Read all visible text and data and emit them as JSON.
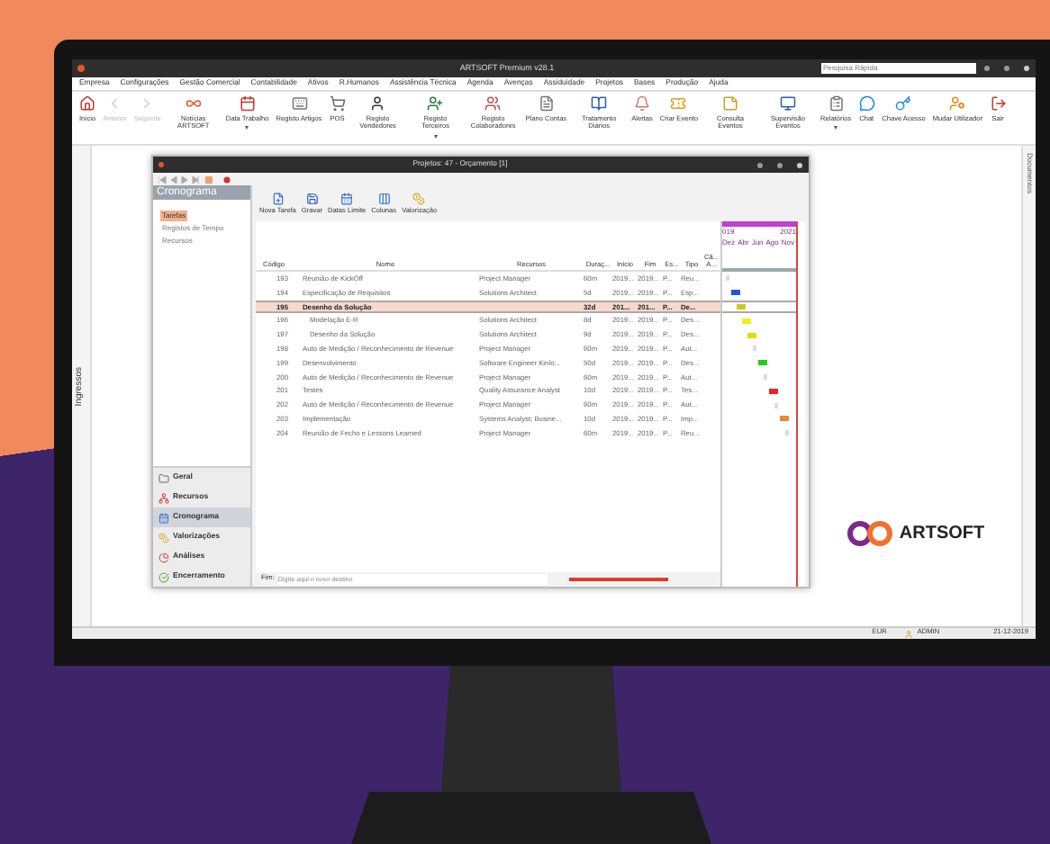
{
  "window": {
    "title": "ARTSOFT Premium v28.1",
    "search": {
      "placeholder": "Pesquisa Rápida"
    }
  },
  "menu": [
    "Empresa",
    "Configurações",
    "Gestão Comercial",
    "Contabilidade",
    "Ativos",
    "R.Humanos",
    "Assistência Técnica",
    "Agenda",
    "Avenças",
    "Assiduidade",
    "Projetos",
    "Bases",
    "Produção",
    "Ajuda"
  ],
  "toolbar": [
    {
      "label": "Início",
      "disabled": false,
      "dropdown": false
    },
    {
      "label": "Anterior",
      "disabled": true,
      "dropdown": false
    },
    {
      "label": "Seguinte",
      "disabled": true,
      "dropdown": false
    },
    {
      "label": "Notícias ARTSOFT",
      "disabled": false,
      "dropdown": false
    },
    {
      "label": "Data Trabalho",
      "disabled": false,
      "dropdown": true
    },
    {
      "label": "Registo Artigos",
      "disabled": false,
      "dropdown": false
    },
    {
      "label": "POS",
      "disabled": false,
      "dropdown": false
    },
    {
      "label": "Registo Vendedores",
      "disabled": false,
      "dropdown": false
    },
    {
      "label": "Registo Terceiros",
      "disabled": false,
      "dropdown": true
    },
    {
      "label": "Registo Colaboradores",
      "disabled": false,
      "dropdown": false
    },
    {
      "label": "Plano Contas",
      "disabled": false,
      "dropdown": false
    },
    {
      "label": "Tratamento Diários",
      "disabled": false,
      "dropdown": false
    },
    {
      "label": "Alertas",
      "disabled": false,
      "dropdown": false
    },
    {
      "label": "Criar Evento",
      "disabled": false,
      "dropdown": false
    },
    {
      "label": "Consulta Eventos",
      "disabled": false,
      "dropdown": false
    },
    {
      "label": "Supervisão Eventos",
      "disabled": false,
      "dropdown": false
    },
    {
      "label": "Relatórios",
      "disabled": false,
      "dropdown": true
    },
    {
      "label": "Chat",
      "disabled": false,
      "dropdown": false
    },
    {
      "label": "Chave Acesso",
      "disabled": false,
      "dropdown": false
    },
    {
      "label": "Mudar Utilizador",
      "disabled": false,
      "dropdown": false
    },
    {
      "label": "Sair",
      "disabled": false,
      "dropdown": false
    }
  ],
  "side_tabs": {
    "left": "Ingressos",
    "right": "Documentos"
  },
  "project_window": {
    "title": "Projetos: 47 - Orçamento [1]",
    "panel_title": "Cronograma",
    "panel_items": [
      {
        "label": "Tarefas",
        "selected": true
      },
      {
        "label": "Registos de Tempo",
        "selected": false
      },
      {
        "label": "Recursos",
        "selected": false
      }
    ],
    "sections": [
      {
        "label": "Geral",
        "selected": false
      },
      {
        "label": "Recursos",
        "selected": false
      },
      {
        "label": "Cronograma",
        "selected": true
      },
      {
        "label": "Valorizações",
        "selected": false
      },
      {
        "label": "Análises",
        "selected": false
      },
      {
        "label": "Encerramento",
        "selected": false
      }
    ],
    "toolbar": [
      "Nova Tarefa",
      "Gravar",
      "Datas Limite",
      "Colunas",
      "Valorização"
    ],
    "table": {
      "columns": [
        "Código",
        "Nome",
        "Recursos",
        "Duraç...",
        "Início",
        "Fim",
        "Es...",
        "Tipo",
        "Cã... A..."
      ],
      "rows": [
        {
          "code": "193",
          "name": "Reunião de KickOff",
          "resources": "Project Manager",
          "duration": "60m",
          "start": "2019...",
          "end": "2019...",
          "state": "P...",
          "type": "Reu...",
          "selected": false,
          "color": "#d8d8f0"
        },
        {
          "code": "194",
          "name": "Especificação de Requisitos",
          "resources": "Solutions Architect",
          "duration": "5d",
          "start": "2019...",
          "end": "2019...",
          "state": "P...",
          "type": "Esp...",
          "selected": false,
          "color": "#2255dd"
        },
        {
          "code": "195",
          "name": "Desenho da Solução",
          "resources": "",
          "duration": "32d",
          "start": "201...",
          "end": "201...",
          "state": "P...",
          "type": "De...",
          "selected": true,
          "color": "#cccc22",
          "children": [
            {
              "code": "196",
              "name": "Modelação E-R",
              "resources": "Solutions Architect",
              "duration": "8d",
              "start": "2019...",
              "end": "2019...",
              "state": "P...",
              "type": "Des...",
              "selected": false,
              "color": "#eeee22"
            },
            {
              "code": "197",
              "name": "Desenho da Solução",
              "resources": "Solutions Architect",
              "duration": "9d",
              "start": "2019...",
              "end": "2019...",
              "state": "P...",
              "type": "Des...",
              "selected": false,
              "color": "#dddd11"
            }
          ]
        },
        {
          "code": "198",
          "name": "Auto de Medição / Reconhecimento de Revenue",
          "resources": "Project Manager",
          "duration": "60m",
          "start": "2019...",
          "end": "2019...",
          "state": "P...",
          "type": "Aut...",
          "selected": false,
          "color": "#d8d8f0"
        },
        {
          "code": "199",
          "name": "Desenvolvimento",
          "resources": "Software Engineer Kinlo...",
          "duration": "50d",
          "start": "2019...",
          "end": "2019...",
          "state": "P...",
          "type": "Des...",
          "selected": false,
          "color": "#22cc22"
        },
        {
          "code": "200",
          "name": "Auto de Medição / Reconhecimento de Revenue",
          "resources": "Project Manager",
          "duration": "60m",
          "start": "2019...",
          "end": "2019...",
          "state": "P...",
          "type": "Aut...",
          "selected": false,
          "color": "#d8d8f0"
        },
        {
          "code": "201",
          "name": "Testes",
          "resources": "Quality Assurance Analyst",
          "duration": "10d",
          "start": "2019...",
          "end": "2019...",
          "state": "P...",
          "type": "Tes...",
          "selected": false,
          "color": "#ee2222"
        },
        {
          "code": "202",
          "name": "Auto de Medição / Reconhecimento de Revenue",
          "resources": "Project Manager",
          "duration": "60m",
          "start": "2019...",
          "end": "2019...",
          "state": "P...",
          "type": "Aut...",
          "selected": false,
          "color": "#d8d8f0"
        },
        {
          "code": "203",
          "name": "Implementação",
          "resources": "Systems Analyst; Busine...",
          "duration": "10d",
          "start": "2019...",
          "end": "2019...",
          "state": "P...",
          "type": "Imp...",
          "selected": false,
          "color": "#e8883a"
        },
        {
          "code": "204",
          "name": "Reunião de Fecho e Lessons Learned",
          "resources": "Project Manager",
          "duration": "60m",
          "start": "2019...",
          "end": "2019...",
          "state": "P...",
          "type": "Reu...",
          "selected": false,
          "color": "#d8d8f0"
        }
      ]
    },
    "gantt": {
      "years": [
        "019",
        "2021"
      ],
      "months": [
        "Dez",
        "Abr",
        "Jun",
        "Ago",
        "Nov"
      ]
    },
    "footer": {
      "label": "Fim:",
      "placeholder": "Digite aqui o novo destino"
    }
  },
  "brand": "ARTSOFT",
  "status_bar": {
    "currency": "EUR",
    "user": "ADMIN",
    "date": "21-12-2019"
  }
}
